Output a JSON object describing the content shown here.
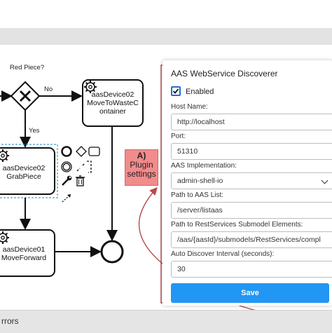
{
  "diagram": {
    "gateway_label": "Red Piece?",
    "flow_no": "No",
    "flow_yes": "Yes",
    "tasks": [
      {
        "lines": [
          "aasDevice02",
          "MoveToWasteC",
          "ontainer"
        ]
      },
      {
        "lines": [
          "aasDevice02",
          "GrabPiece"
        ]
      },
      {
        "lines": [
          "aasDevice01",
          "MoveForward"
        ]
      }
    ]
  },
  "callout": {
    "label": "A)",
    "lines": [
      "Plugin",
      "settings"
    ]
  },
  "panel": {
    "title": "AAS WebService Discoverer",
    "enabled_label": "Enabled",
    "enabled_checked": true,
    "fields": [
      {
        "label": "Host Name:",
        "value": "http://localhost"
      },
      {
        "label": "Port:",
        "value": "51310"
      },
      {
        "label": "AAS Implementation:",
        "value": "admin-shell-io"
      },
      {
        "label": "Path to AAS List:",
        "value": "/server/listaas"
      },
      {
        "label": "Path to RestServices Submodel Elements:",
        "value": "/aas/{aasId}/submodels/RestServices/compl"
      },
      {
        "label": "Auto Discover Interval (seconds):",
        "value": "30"
      }
    ],
    "save_label": "Save"
  },
  "bottom_bar": {
    "label": "rrors"
  },
  "colors": {
    "accent": "#2196f3",
    "checkbox": "#1f6fd6",
    "callout": "#f28b8b",
    "arrow_red": "#b84a4a",
    "selection": "#3a9fd6"
  }
}
